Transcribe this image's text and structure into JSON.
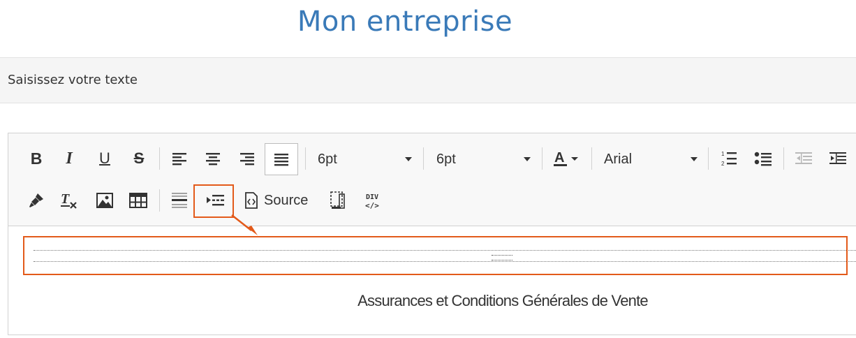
{
  "site": {
    "title": "Mon entreprise"
  },
  "section": {
    "label": "Saisissez votre texte"
  },
  "toolbar": {
    "row1": {
      "bold_icon": "bold-icon",
      "italic_icon": "italic-icon",
      "underline_icon": "underline-icon",
      "strike_icon": "strikethrough-icon",
      "align_left_icon": "align-left-icon",
      "align_center_icon": "align-center-icon",
      "align_right_icon": "align-right-icon",
      "justify_icon": "justify-icon",
      "font_size_1": "6pt",
      "font_size_2": "6pt",
      "text_color_icon": "text-color-icon",
      "font_family": "Arial",
      "numbered_list_icon": "numbered-list-icon",
      "bulleted_list_icon": "bulleted-list-icon",
      "outdent_icon": "outdent-icon",
      "indent_icon": "indent-icon"
    },
    "row2": {
      "paint_icon": "copy-format-icon",
      "clear_format_icon": "remove-format-icon",
      "image_icon": "image-icon",
      "table_icon": "table-icon",
      "hr_icon": "horizontal-line-icon",
      "pagebreak_icon": "page-break-icon",
      "source_label": "Source",
      "maximize_icon": "maximize-icon",
      "div_icon": "div-container-icon"
    }
  },
  "content": {
    "heading": "Assurances et Conditions Générales de Vente"
  },
  "annotation": {
    "color": "#e35a1a"
  },
  "colors": {
    "title": "#3a7ab8",
    "bar": "#f5f5f5",
    "toolbar": "#f8f8f8"
  }
}
